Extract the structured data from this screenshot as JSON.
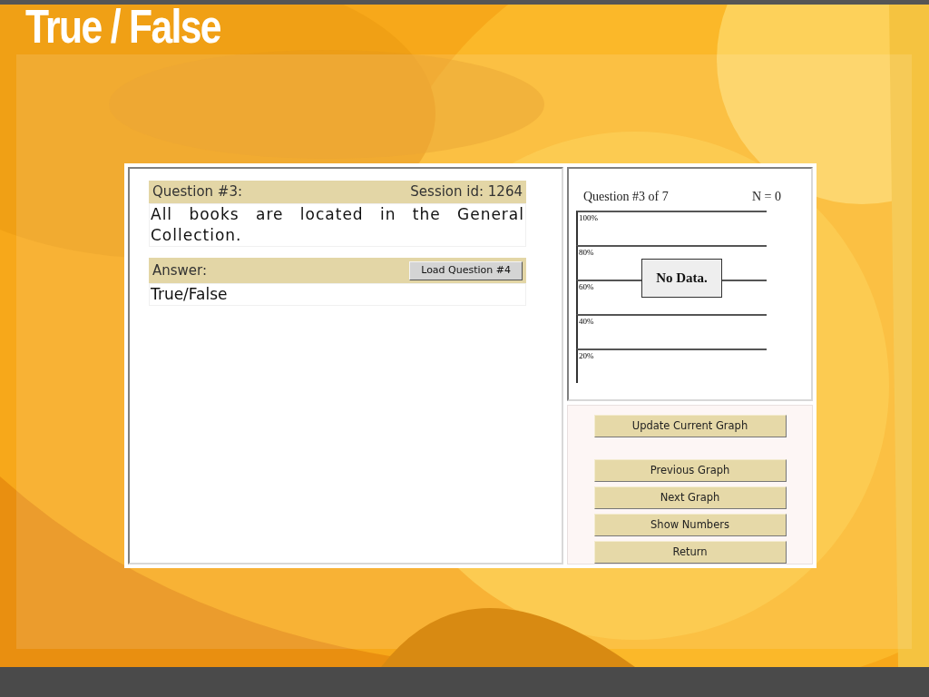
{
  "slide_title": "True / False",
  "question": {
    "label": "Question #3:",
    "session": "Session id: 1264",
    "text": "All books are located in the General Collection."
  },
  "answer": {
    "label": "Answer:",
    "load_button": "Load Question #4",
    "value": "True/False"
  },
  "graph": {
    "title": "Question #3 of 7",
    "count": "N = 0",
    "gridlines": [
      "100%",
      "80%",
      "60%",
      "40%",
      "20%"
    ],
    "message": "No Data."
  },
  "update_button": "Update Current Graph",
  "nav_buttons": [
    "Previous Graph",
    "Next Graph",
    "Show Numbers",
    "Return"
  ]
}
